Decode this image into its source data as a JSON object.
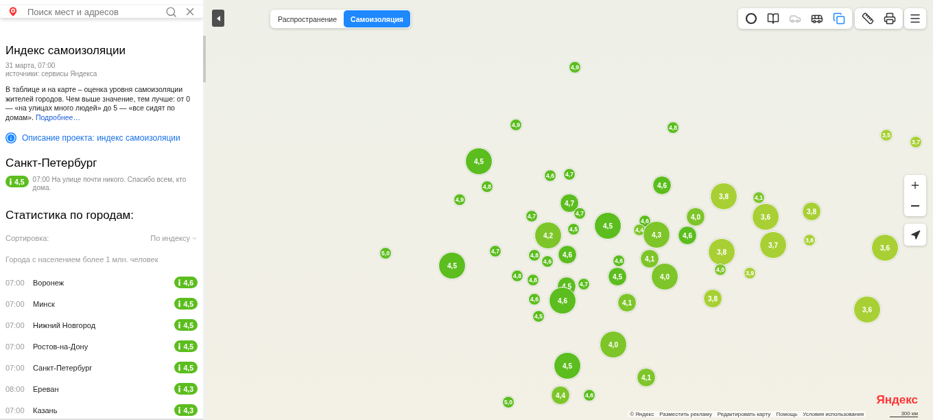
{
  "search": {
    "placeholder": "Поиск мест и адресов"
  },
  "panel": {
    "title": "Индекс самоизоляции",
    "date": "31 марта, 07:00",
    "sources": "источники: сервисы Яндекса",
    "description": "В таблице и на карте – оценка уровня самоизоляции жителей городов. Чем выше значение, тем лучше: от 0 — «на улицах много людей» до 5 — «все сидят по домам».",
    "more_link": "Подробнее…",
    "project_link": "Описание проекта: индекс самоизоляции",
    "city": {
      "name": "Санкт-Петербург",
      "value": "4,5",
      "note": "07:00 На улице почти никого. Спасибо всем, кто дома."
    },
    "stats": {
      "title": "Статистика по городам:",
      "sort_label": "Сортировка:",
      "sort_value": "По индексу",
      "group_label": "Города с населением более 1 млн. человек",
      "rows": [
        {
          "time": "07:00",
          "city": "Воронеж",
          "value": "4,6"
        },
        {
          "time": "07:00",
          "city": "Минск",
          "value": "4,5"
        },
        {
          "time": "07:00",
          "city": "Нижний Новгород",
          "value": "4,5"
        },
        {
          "time": "07:00",
          "city": "Ростов-на-Дону",
          "value": "4,5"
        },
        {
          "time": "07:00",
          "city": "Санкт-Петербург",
          "value": "4,5"
        },
        {
          "time": "08:00",
          "city": "Ереван",
          "value": "4,3"
        },
        {
          "time": "07:00",
          "city": "Казань",
          "value": "4,3"
        }
      ]
    }
  },
  "mode_switch": [
    {
      "label": "Распространение",
      "selected": false
    },
    {
      "label": "Самоизоляция",
      "selected": true
    }
  ],
  "toolbar": [
    {
      "kind": "traffic",
      "selected": false,
      "disabled": false
    },
    {
      "kind": "panorama",
      "selected": false,
      "disabled": false
    },
    {
      "kind": "cameras",
      "selected": false,
      "disabled": true
    },
    {
      "kind": "transit",
      "selected": false,
      "disabled": false
    },
    {
      "kind": "layers",
      "selected": true,
      "disabled": false
    }
  ],
  "markers": [
    {
      "value": "4,9",
      "color": "#5cbd1e"
    },
    {
      "value": "4,9",
      "color": "#5cbd1e"
    },
    {
      "value": "4,8",
      "color": "#5cbd1e"
    },
    {
      "value": "3,5",
      "color": "#a8d035"
    },
    {
      "value": "3,7",
      "color": "#a8d035"
    },
    {
      "value": "4,5",
      "color": "#5cbd1e"
    },
    {
      "value": "4,6",
      "color": "#5cbd1e"
    },
    {
      "value": "4,7",
      "color": "#5cbd1e"
    },
    {
      "value": "4,8",
      "color": "#5cbd1e"
    },
    {
      "value": "4,6",
      "color": "#5cbd1e"
    },
    {
      "value": "4,9",
      "color": "#5cbd1e"
    },
    {
      "value": "3,8",
      "color": "#a8d035"
    },
    {
      "value": "4,1",
      "color": "#7ec52a"
    },
    {
      "value": "4,7",
      "color": "#5cbd1e"
    },
    {
      "value": "4,7",
      "color": "#5cbd1e"
    },
    {
      "value": "4,7",
      "color": "#5cbd1e"
    },
    {
      "value": "4,0",
      "color": "#7ec52a"
    },
    {
      "value": "3,6",
      "color": "#a8d035"
    },
    {
      "value": "3,8",
      "color": "#a8d035"
    },
    {
      "value": "4,6",
      "color": "#5cbd1e"
    },
    {
      "value": "4,5",
      "color": "#5cbd1e"
    },
    {
      "value": "4,5",
      "color": "#5cbd1e"
    },
    {
      "value": "4,4",
      "color": "#7ec52a"
    },
    {
      "value": "4,2",
      "color": "#7ec52a"
    },
    {
      "value": "4,3",
      "color": "#7ec52a"
    },
    {
      "value": "4,6",
      "color": "#5cbd1e"
    },
    {
      "value": "3,6",
      "color": "#a8d035"
    },
    {
      "value": "3,7",
      "color": "#a8d035"
    },
    {
      "value": "3,6",
      "color": "#a8d035"
    },
    {
      "value": "5,0",
      "color": "#5cbd1e"
    },
    {
      "value": "4,7",
      "color": "#5cbd1e"
    },
    {
      "value": "4,8",
      "color": "#5cbd1e"
    },
    {
      "value": "4,6",
      "color": "#5cbd1e"
    },
    {
      "value": "3,8",
      "color": "#a8d035"
    },
    {
      "value": "4,6",
      "color": "#5cbd1e"
    },
    {
      "value": "4,6",
      "color": "#5cbd1e"
    },
    {
      "value": "4,1",
      "color": "#7ec52a"
    },
    {
      "value": "4,5",
      "color": "#5cbd1e"
    },
    {
      "value": "4,0",
      "color": "#7ec52a"
    },
    {
      "value": "3,9",
      "color": "#a8d035"
    },
    {
      "value": "4,8",
      "color": "#5cbd1e"
    },
    {
      "value": "4,5",
      "color": "#5cbd1e"
    },
    {
      "value": "4,0",
      "color": "#7ec52a"
    },
    {
      "value": "4,8",
      "color": "#5cbd1e"
    },
    {
      "value": "4,5",
      "color": "#5cbd1e"
    },
    {
      "value": "4,7",
      "color": "#5cbd1e"
    },
    {
      "value": "4,6",
      "color": "#5cbd1e"
    },
    {
      "value": "4,6",
      "color": "#5cbd1e"
    },
    {
      "value": "3,8",
      "color": "#a8d035"
    },
    {
      "value": "4,1",
      "color": "#7ec52a"
    },
    {
      "value": "3,6",
      "color": "#a8d035"
    },
    {
      "value": "4,5",
      "color": "#5cbd1e"
    },
    {
      "value": "4,0",
      "color": "#7ec52a"
    },
    {
      "value": "4,5",
      "color": "#5cbd1e"
    },
    {
      "value": "4,1",
      "color": "#7ec52a"
    },
    {
      "value": "4,4",
      "color": "#7ec52a"
    },
    {
      "value": "4,6",
      "color": "#5cbd1e"
    },
    {
      "value": "5,0",
      "color": "#5cbd1e"
    }
  ],
  "attribution": [
    "© Яндекс",
    "Разместить рекламу",
    "Редактировать карту",
    "Помощь",
    "Условия использования"
  ],
  "scale": "300 км",
  "logo": "Яндекс"
}
